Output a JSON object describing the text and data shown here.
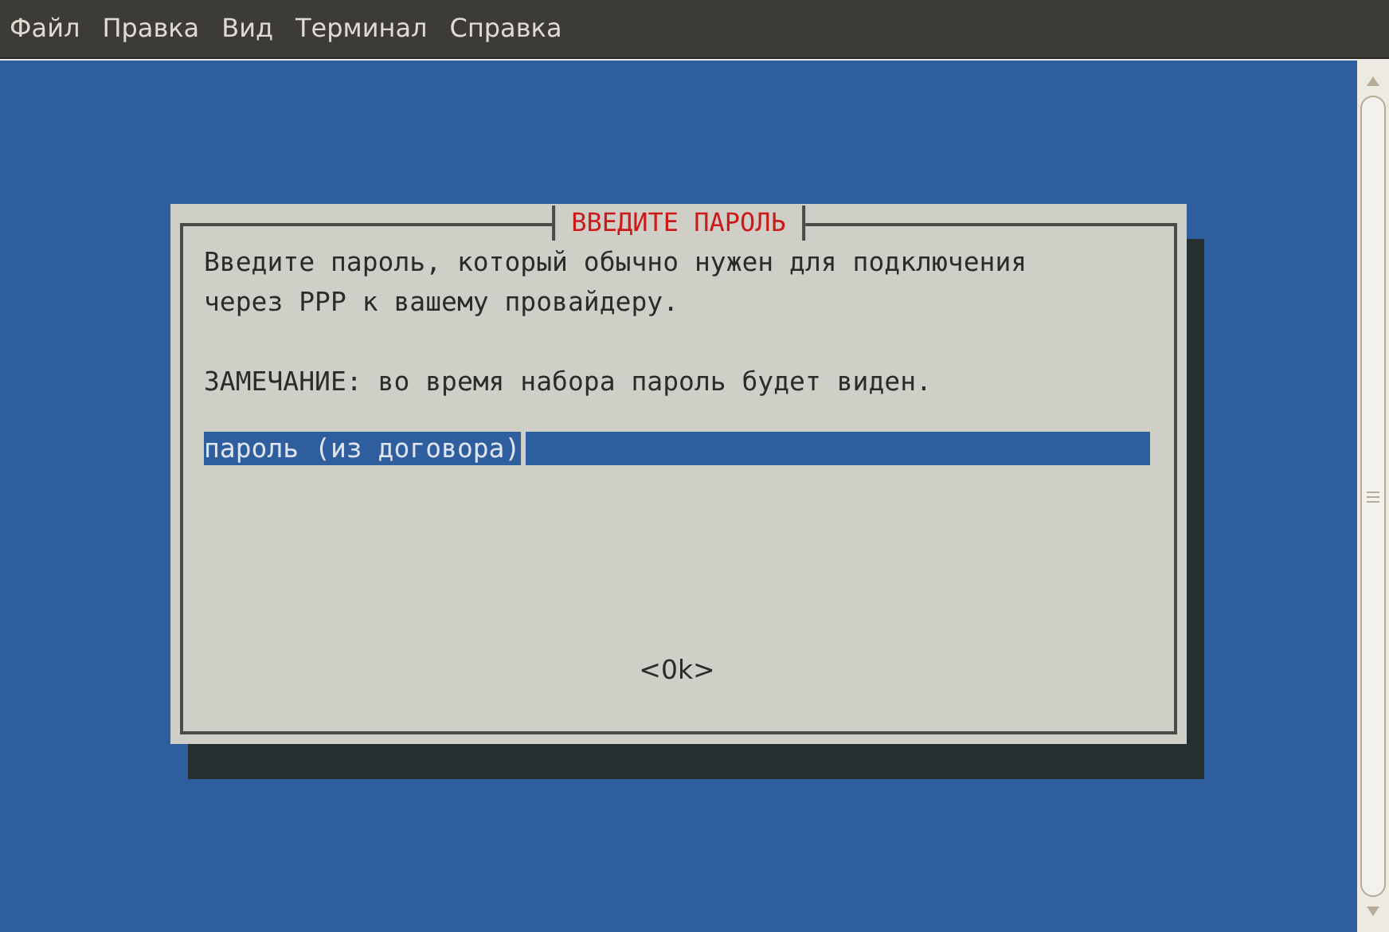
{
  "menu": [
    "Файл",
    "Правка",
    "Вид",
    "Терминал",
    "Справка"
  ],
  "dialog": {
    "title": "ВВЕДИТЕ ПАРОЛЬ",
    "message": [
      "Введите пароль, который обычно нужен для подключения",
      "через PPP к вашему провайдеру."
    ],
    "note": "ЗАМЕЧАНИЕ: во время набора пароль будет виден.",
    "input": {
      "value": "пароль (из договора)"
    },
    "buttons": [
      {
        "label": "<0k>"
      }
    ]
  }
}
